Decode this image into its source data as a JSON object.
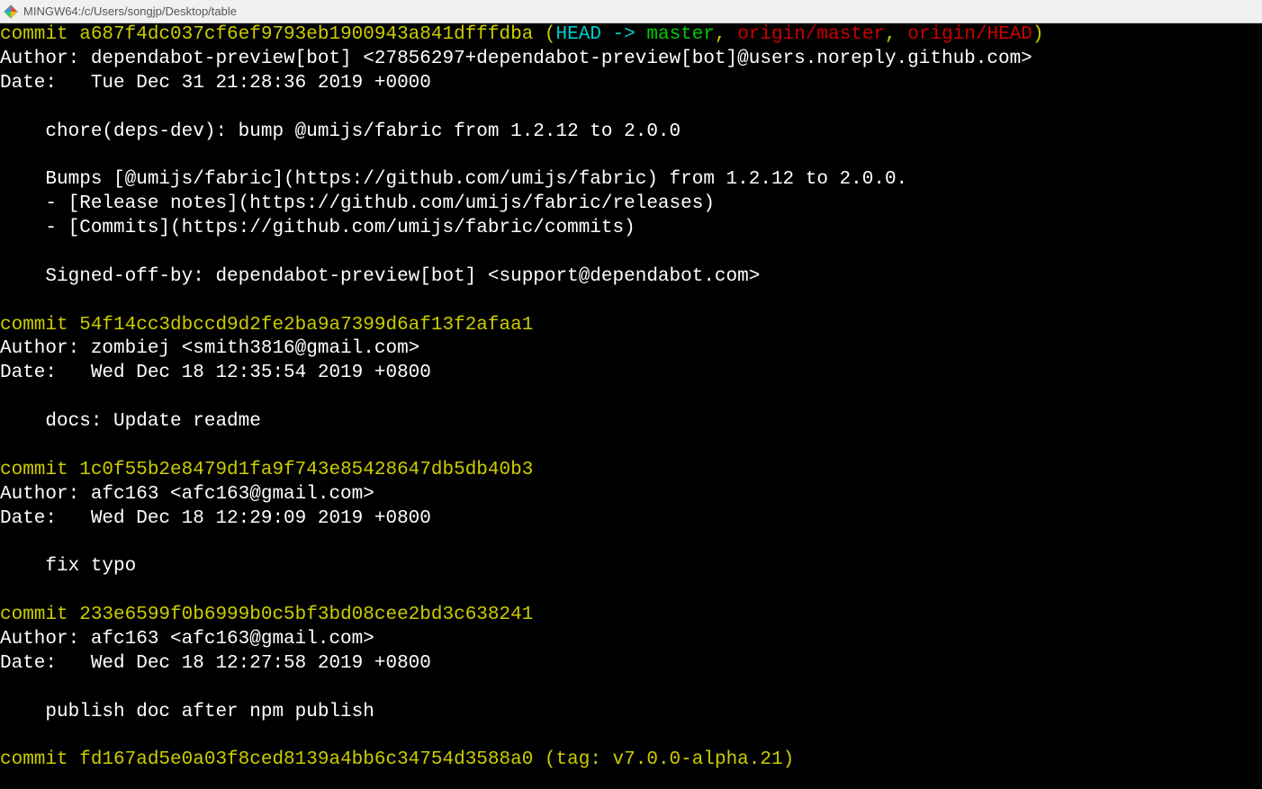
{
  "titlebar": {
    "title": "MINGW64:/c/Users/songjp/Desktop/table"
  },
  "colors": {
    "commit": "#cccc00",
    "head": "#00cccc",
    "branch": "#00cc00",
    "remote": "#cc0000",
    "tag": "#cccc00"
  },
  "commits": [
    {
      "hash": "a687f4dc037cf6ef9793eb1900943a841dfffdba",
      "refs_prefix": "(",
      "head": "HEAD -> ",
      "local_branch": "master",
      "sep1": ", ",
      "remote1": "origin/master",
      "sep2": ", ",
      "remote2": "origin/HEAD",
      "refs_suffix": ")",
      "author": "Author: dependabot-preview[bot] <27856297+dependabot-preview[bot]@users.noreply.github.com>",
      "date": "Date:   Tue Dec 31 21:28:36 2019 +0000",
      "body": [
        "",
        "    chore(deps-dev): bump @umijs/fabric from 1.2.12 to 2.0.0",
        "",
        "    Bumps [@umijs/fabric](https://github.com/umijs/fabric) from 1.2.12 to 2.0.0.",
        "    - [Release notes](https://github.com/umijs/fabric/releases)",
        "    - [Commits](https://github.com/umijs/fabric/commits)",
        "",
        "    Signed-off-by: dependabot-preview[bot] <support@dependabot.com>",
        ""
      ]
    },
    {
      "hash": "54f14cc3dbccd9d2fe2ba9a7399d6af13f2afaa1",
      "author": "Author: zombiej <smith3816@gmail.com>",
      "date": "Date:   Wed Dec 18 12:35:54 2019 +0800",
      "body": [
        "",
        "    docs: Update readme",
        ""
      ]
    },
    {
      "hash": "1c0f55b2e8479d1fa9f743e85428647db5db40b3",
      "author": "Author: afc163 <afc163@gmail.com>",
      "date": "Date:   Wed Dec 18 12:29:09 2019 +0800",
      "body": [
        "",
        "    fix typo",
        ""
      ]
    },
    {
      "hash": "233e6599f0b6999b0c5bf3bd08cee2bd3c638241",
      "author": "Author: afc163 <afc163@gmail.com>",
      "date": "Date:   Wed Dec 18 12:27:58 2019 +0800",
      "body": [
        "",
        "    publish doc after npm publish",
        ""
      ]
    },
    {
      "hash": "fd167ad5e0a03f8ced8139a4bb6c34754d3588a0",
      "tag_prefix": "(",
      "tag_label": "tag: ",
      "tag_name": "v7.0.0-alpha.21",
      "tag_suffix": ")"
    }
  ],
  "labels": {
    "commit_word": "commit "
  }
}
